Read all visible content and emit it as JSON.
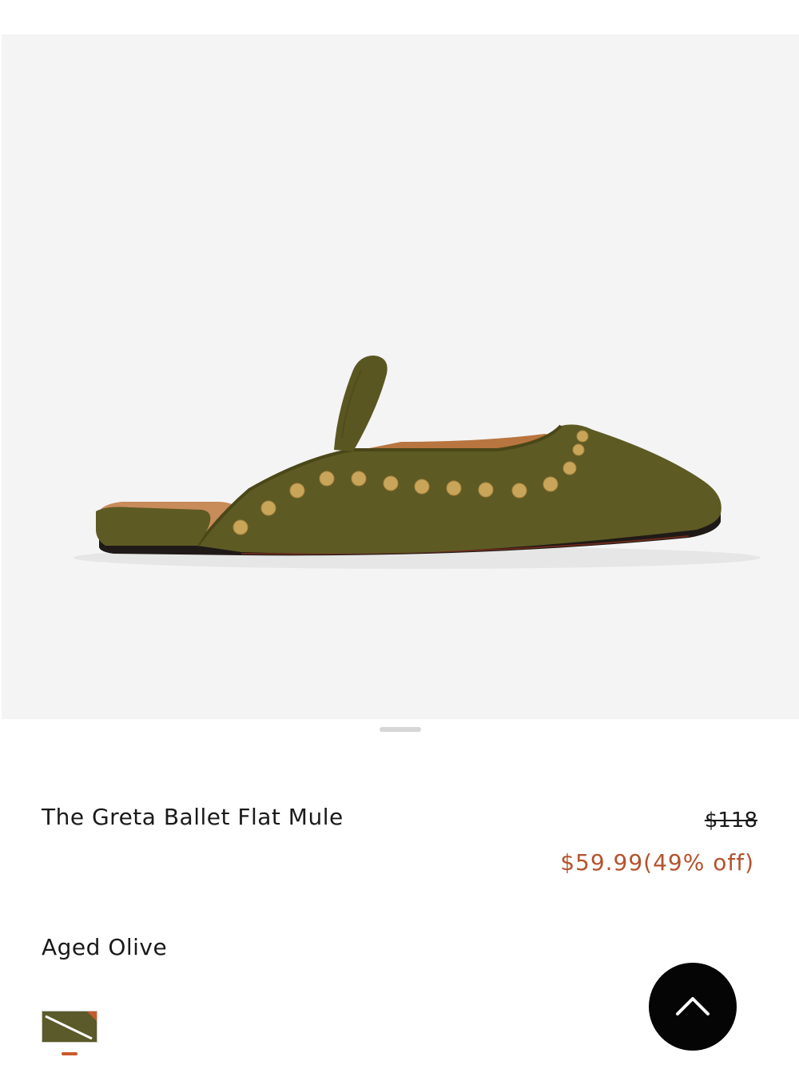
{
  "header": {
    "logo_glyph": "⌒"
  },
  "gallery": {
    "image_alt": "Olive suede ballet flat mule with gold studs",
    "active_slide": 1
  },
  "product": {
    "title": "The Greta Ballet Flat Mule",
    "price_original": "$118",
    "price_sale": "$59.99(49% off)",
    "sale_color": "#b4532e"
  },
  "variant": {
    "color_name": "Aged Olive",
    "swatch_color": "#5a5a2a",
    "swatch_status": "unavailable",
    "selected_indicator_color": "#c75a2c"
  },
  "actions": {
    "back_to_top_icon": "chevron-up-icon"
  }
}
